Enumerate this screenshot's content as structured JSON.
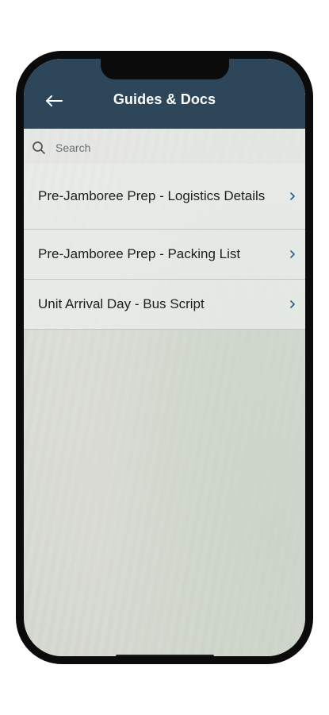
{
  "header": {
    "title": "Guides & Docs",
    "back_icon": "arrow-left-icon"
  },
  "search": {
    "placeholder": "Search",
    "value": ""
  },
  "list": {
    "items": [
      {
        "label": "Pre-Jamboree Prep - Logistics Details"
      },
      {
        "label": "Pre-Jamboree Prep - Packing List"
      },
      {
        "label": "Unit Arrival Day - Bus Script"
      }
    ]
  },
  "colors": {
    "header_bg": "#2d4659",
    "chevron": "#2d5c8a",
    "text": "#1e1e1e"
  }
}
